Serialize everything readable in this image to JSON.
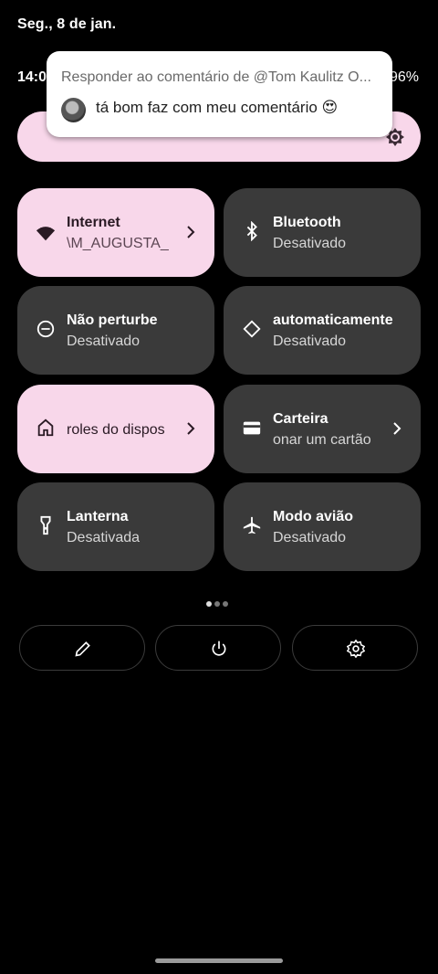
{
  "status": {
    "date": "Seg., 8 de jan.",
    "time": "14:0",
    "battery": "96%"
  },
  "notification": {
    "title": "Responder ao comentário de @Tom Kaulitz O...",
    "body": "tá bom faz com meu comentário 😍"
  },
  "tiles": [
    {
      "title": "Internet",
      "subtitle": "\\M_AUGUSTA_",
      "state": "on",
      "icon": "wifi-icon"
    },
    {
      "title": "Bluetooth",
      "subtitle": "Desativado",
      "state": "off",
      "icon": "bluetooth-icon"
    },
    {
      "title": "Não perturbe",
      "subtitle": "Desativado",
      "state": "off",
      "icon": "do-not-disturb-icon"
    },
    {
      "title": "automaticamente",
      "subtitle": "Desativado",
      "state": "off",
      "icon": "auto-rotate-icon"
    },
    {
      "title": "roles do dispos",
      "subtitle": "",
      "state": "on",
      "icon": "home-icon"
    },
    {
      "title": "Carteira",
      "subtitle": "onar um cartão",
      "state": "off",
      "icon": "wallet-icon"
    },
    {
      "title": "Lanterna",
      "subtitle": "Desativada",
      "state": "off",
      "icon": "flashlight-icon"
    },
    {
      "title": "Modo avião",
      "subtitle": "Desativado",
      "state": "off",
      "icon": "airplane-icon"
    }
  ],
  "pager": {
    "pages": 3,
    "current": 1
  },
  "actions": [
    {
      "icon": "edit-icon"
    },
    {
      "icon": "power-icon"
    },
    {
      "icon": "settings-icon"
    }
  ],
  "colors": {
    "tile_on": "#f8d7ea",
    "tile_off": "#3a3a3a",
    "background": "#000000"
  }
}
